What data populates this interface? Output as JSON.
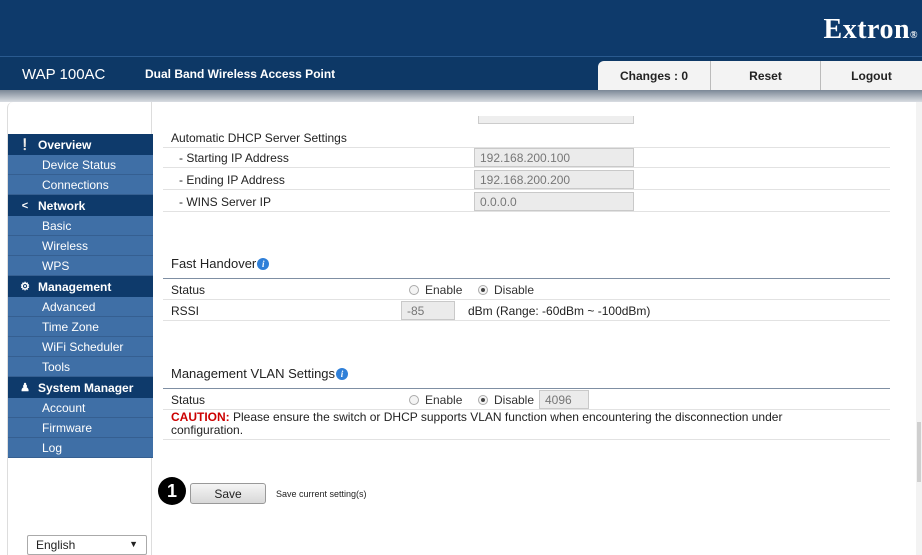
{
  "header": {
    "brand": "Extron",
    "brand_mark": "®",
    "model": "WAP 100AC",
    "subtitle": "Dual Band Wireless Access Point",
    "changes_label": "Changes : 0",
    "reset_label": "Reset",
    "logout_label": "Logout"
  },
  "sidebar": {
    "groups": [
      {
        "label": "Overview",
        "icon": "info-circle-icon",
        "items": [
          "Device Status",
          "Connections"
        ]
      },
      {
        "label": "Network",
        "icon": "share-icon",
        "items": [
          "Basic",
          "Wireless",
          "WPS"
        ]
      },
      {
        "label": "Management",
        "icon": "gear-icon",
        "items": [
          "Advanced",
          "Time Zone",
          "WiFi Scheduler",
          "Tools"
        ]
      },
      {
        "label": "System Manager",
        "icon": "user-icon",
        "items": [
          "Account",
          "Firmware",
          "Log"
        ]
      }
    ],
    "language": "English"
  },
  "dhcp": {
    "title": "Automatic DHCP Server Settings",
    "start_label": "- Starting IP Address",
    "start_value": "192.168.200.100",
    "end_label": "- Ending IP Address",
    "end_value": "192.168.200.200",
    "wins_label": "- WINS Server IP",
    "wins_value": "0.0.0.0"
  },
  "fast_handover": {
    "title": "Fast Handover",
    "status_label": "Status",
    "enable_label": "Enable",
    "disable_label": "Disable",
    "selected": "Disable",
    "rssi_label": "RSSI",
    "rssi_value": "-85",
    "rssi_hint": "dBm (Range: -60dBm ~ -100dBm)"
  },
  "mgmt_vlan": {
    "title": "Management VLAN Settings",
    "status_label": "Status",
    "enable_label": "Enable",
    "disable_label": "Disable",
    "selected": "Disable",
    "vlan_id": "4096",
    "caution_label": "CAUTION:",
    "caution_text": " Please ensure the switch or DHCP supports VLAN function when encountering the disconnection under configuration."
  },
  "footer": {
    "callout": "1",
    "save_label": "Save",
    "save_note": "Save current setting(s)"
  },
  "colors": {
    "header_bg": "#0e3a6b",
    "menu_item_bg": "#3f6fa6",
    "caution": "#cc0000",
    "info_icon": "#2f7fd8"
  }
}
